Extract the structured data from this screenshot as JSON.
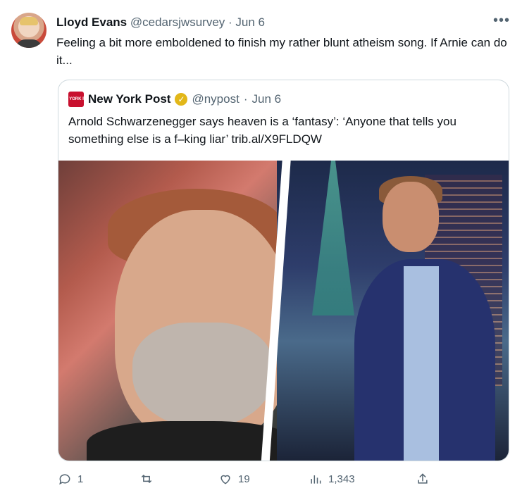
{
  "author": {
    "name": "Lloyd Evans",
    "handle": "@cedarsjwsurvey",
    "separator": "·",
    "date": "Jun 6",
    "avatar_icon": "user-avatar"
  },
  "more_label": "•••",
  "tweet_text": "Feeling a bit more emboldened to finish my rather blunt atheism song. If Arnie can do it...",
  "quote": {
    "name": "New York Post",
    "handle": "@nypost",
    "separator": "·",
    "date": "Jun 6",
    "logo_text": "NEW YORK POST",
    "verified_icon": "verified-badge-icon",
    "text": "Arnold Schwarzenegger says heaven is a ‘fantasy’: ‘Anyone that tells you something else is a f–king liar’ trib.al/X9FLDQW"
  },
  "actions": {
    "reply_count": "1",
    "retweet_count": "",
    "like_count": "19",
    "views_count": "1,343"
  },
  "colors": {
    "text": "#0f1419",
    "secondary": "#536471",
    "border": "#cfd9de",
    "verified_gold": "#e2b719",
    "nyp_red": "#c8102e"
  }
}
